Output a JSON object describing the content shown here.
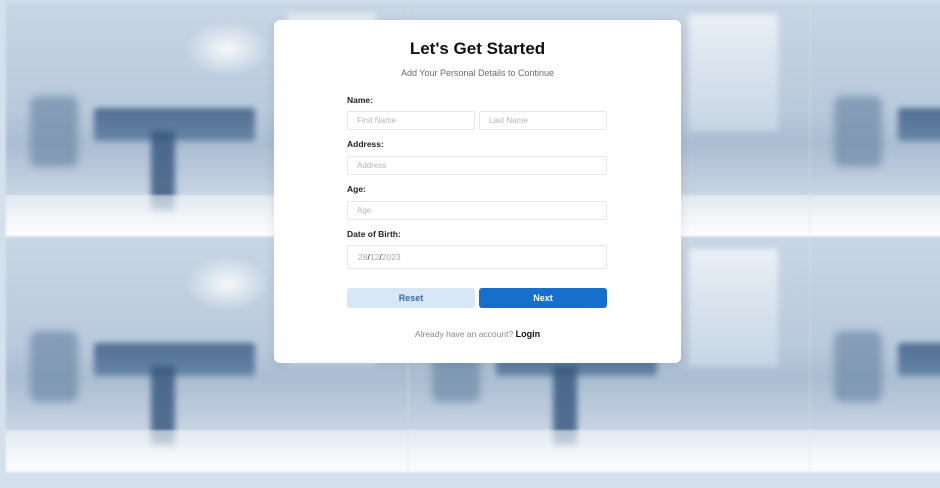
{
  "form": {
    "title": "Let's Get Started",
    "subtitle": "Add Your Personal Details to Continue",
    "name_label": "Name:",
    "first_name_placeholder": "First Name",
    "last_name_placeholder": "Last Name",
    "address_label": "Address:",
    "address_placeholder": "Address",
    "age_label": "Age:",
    "age_placeholder": "Age",
    "dob_label": "Date of Birth:",
    "dob_day": "28",
    "dob_month": "12",
    "dob_year": "2023",
    "dob_separator": "/",
    "reset_label": "Reset",
    "next_label": "Next",
    "footer_text": "Already have an account?",
    "login_label": "Login"
  },
  "colors": {
    "primary": "#1570cd",
    "secondary": "#d8e7f5",
    "background": "#d4e0ec"
  }
}
